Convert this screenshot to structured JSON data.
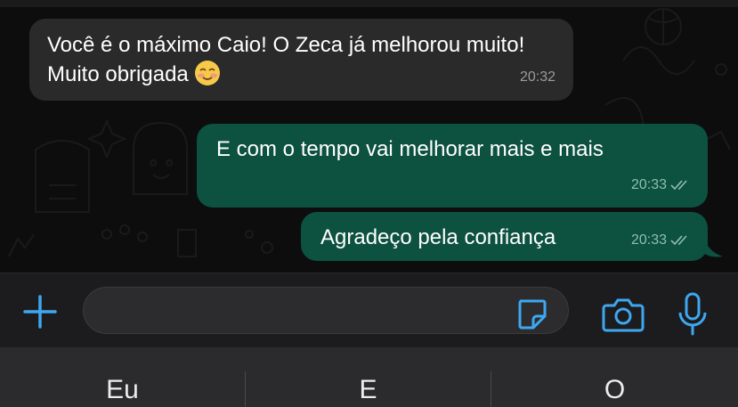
{
  "messages": [
    {
      "direction": "incoming",
      "text": "Você é o máximo Caio! O Zeca já melhorou muito! Muito obrigada",
      "emoji": "smiling-face-with-blush",
      "time": "20:32"
    },
    {
      "direction": "outgoing",
      "text": "E com o tempo vai melhorar mais e mais",
      "time": "20:33",
      "status": "read-double-check"
    },
    {
      "direction": "outgoing",
      "text": "Agradeço pela confiança",
      "time": "20:33",
      "status": "read-double-check"
    }
  ],
  "composer": {
    "placeholder": "",
    "icons": [
      "plus-icon",
      "sticker-icon",
      "camera-icon",
      "microphone-icon"
    ]
  },
  "keyboard": {
    "suggestions": [
      "Eu",
      "E",
      "O"
    ]
  },
  "colors": {
    "accent": "#3ea7f0",
    "incoming_bubble": "#2a2a2b",
    "outgoing_bubble": "#0d5140",
    "background": "#0d0d0d"
  }
}
